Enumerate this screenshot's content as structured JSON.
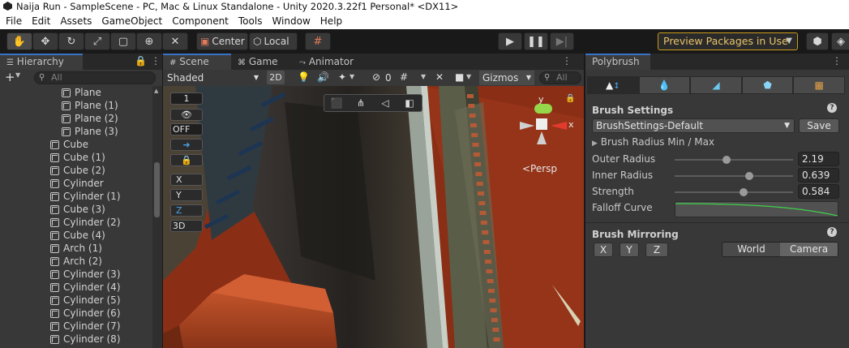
{
  "window": {
    "title": "Naija Run - SampleScene - PC, Mac & Linux Standalone - Unity 2020.3.22f1 Personal* <DX11>"
  },
  "menu": [
    "File",
    "Edit",
    "Assets",
    "GameObject",
    "Component",
    "Tools",
    "Window",
    "Help"
  ],
  "toolbar": {
    "pivot_label": "Center",
    "space_label": "Local",
    "preview_packages": "Preview Packages in Use"
  },
  "hierarchy": {
    "tab": "Hierarchy",
    "add_label": "+",
    "search_placeholder": "All",
    "items": [
      {
        "name": "Plane",
        "indent": 1
      },
      {
        "name": "Plane (1)",
        "indent": 1
      },
      {
        "name": "Plane (2)",
        "indent": 1
      },
      {
        "name": "Plane (3)",
        "indent": 1
      },
      {
        "name": "Cube",
        "indent": 0
      },
      {
        "name": "Cube (1)",
        "indent": 0
      },
      {
        "name": "Cube (2)",
        "indent": 0
      },
      {
        "name": "Cylinder",
        "indent": 0
      },
      {
        "name": "Cylinder (1)",
        "indent": 0
      },
      {
        "name": "Cube (3)",
        "indent": 0
      },
      {
        "name": "Cylinder (2)",
        "indent": 0
      },
      {
        "name": "Cube (4)",
        "indent": 0
      },
      {
        "name": "Arch (1)",
        "indent": 0
      },
      {
        "name": "Arch (2)",
        "indent": 0
      },
      {
        "name": "Cylinder (3)",
        "indent": 0
      },
      {
        "name": "Cylinder (4)",
        "indent": 0
      },
      {
        "name": "Cylinder (5)",
        "indent": 0
      },
      {
        "name": "Cylinder (6)",
        "indent": 0
      },
      {
        "name": "Cylinder (7)",
        "indent": 0
      },
      {
        "name": "Cylinder (8)",
        "indent": 0
      }
    ]
  },
  "scene": {
    "tabs": [
      "Scene",
      "Game",
      "Animator"
    ],
    "draw_mode": "Shaded",
    "mode_2d": "2D",
    "hidden_count": "0",
    "gizmos": "Gizmos",
    "search_placeholder": "All",
    "persp": "<Persp",
    "overlay": {
      "brush_count": "1",
      "off_label": "OFF",
      "x": "X",
      "y": "Y",
      "z": "Z",
      "threed": "3D"
    },
    "axis_x": "x",
    "axis_y": "y"
  },
  "polybrush": {
    "tab": "Polybrush",
    "brush_settings": {
      "title": "Brush Settings",
      "preset": "BrushSettings-Default",
      "save": "Save",
      "radius_minmax": "Brush Radius Min / Max",
      "outer_radius": {
        "label": "Outer Radius",
        "value": "2.19",
        "fraction": 0.44
      },
      "inner_radius": {
        "label": "Inner Radius",
        "value": "0.639",
        "fraction": 0.63
      },
      "strength": {
        "label": "Strength",
        "value": "0.584",
        "fraction": 0.58
      },
      "falloff_label": "Falloff Curve"
    },
    "mirroring": {
      "title": "Brush Mirroring",
      "axes": [
        "X",
        "Y",
        "Z"
      ],
      "spaces": [
        "World",
        "Camera"
      ],
      "active_space": "Camera"
    }
  },
  "colors": {
    "accent_tab": "#3a72c6",
    "preview_border": "#c99a1a",
    "ground": "#8a2e16"
  }
}
